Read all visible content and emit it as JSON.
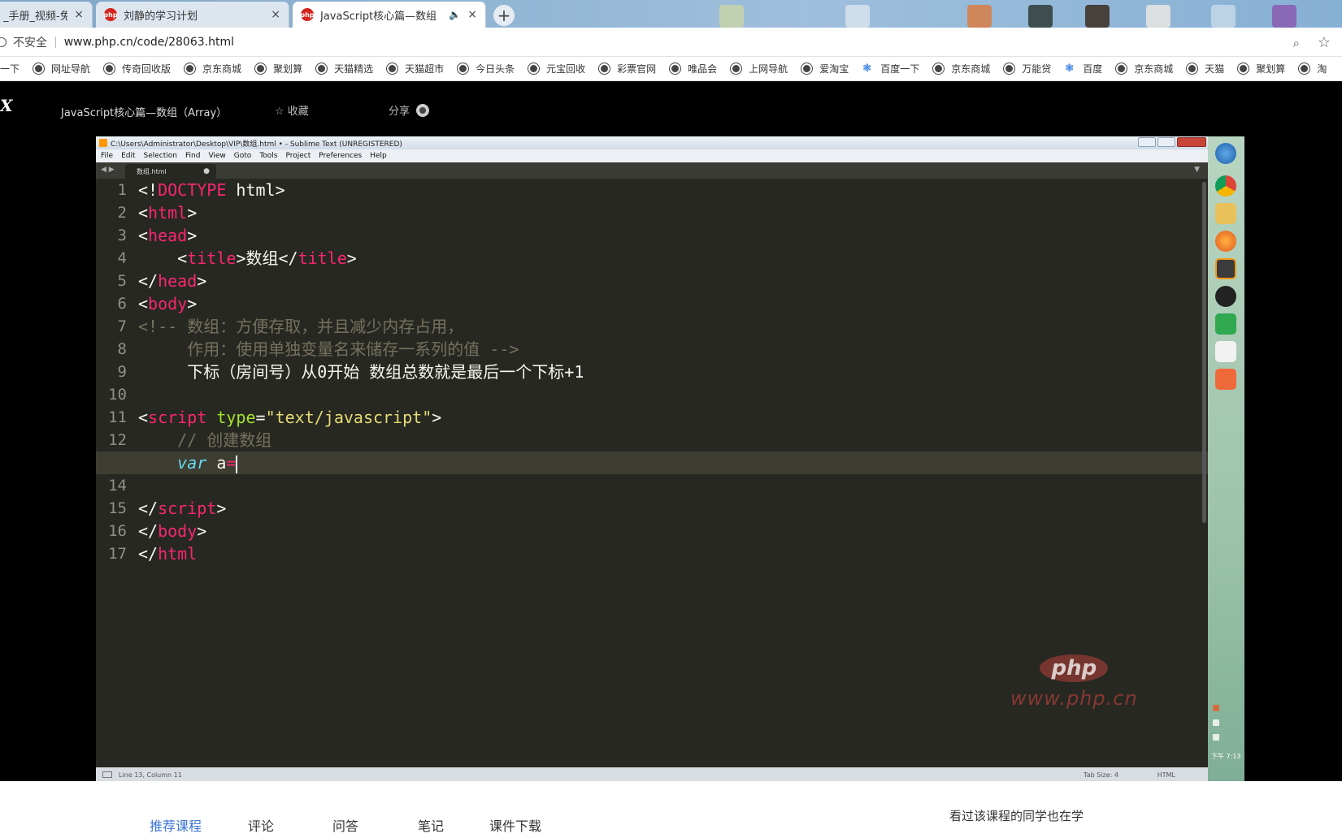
{
  "browser": {
    "tabs": [
      {
        "label": "_手册_视频-免费",
        "close": "×"
      },
      {
        "label": "刘静的学习计划",
        "close": "×",
        "icon": "php"
      },
      {
        "label": "JavaScript核心篇—数组（A",
        "close": "×",
        "icon": "php",
        "audio": "🔈"
      }
    ],
    "new_tab": "+",
    "insecure_label": "不安全",
    "url": "www.php.cn/code/28063.html",
    "bookmarks": [
      "一下",
      "网址导航",
      "传奇回收版",
      "京东商城",
      "聚划算",
      "天猫精选",
      "天猫超市",
      "今日头条",
      "元宝回收",
      "彩票官网",
      "唯品会",
      "上网导航",
      "爱淘宝",
      "百度一下",
      "京东商城",
      "万能贷",
      "百度",
      "京东商城",
      "天猫",
      "聚划算",
      "淘"
    ]
  },
  "page": {
    "logo": "X",
    "course_title": "JavaScript核心篇—数组（Array）",
    "favorite_label": "☆ 收藏",
    "share_label": "分享"
  },
  "editor": {
    "window_title": "C:\\Users\\Administrator\\Desktop\\VIP\\数组.html • - Sublime Text (UNREGISTERED)",
    "menu": [
      "File",
      "Edit",
      "Selection",
      "Find",
      "View",
      "Goto",
      "Tools",
      "Project",
      "Preferences",
      "Help"
    ],
    "tab_name": "数组.html",
    "tab_dot": "●",
    "line_numbers": [
      "1",
      "2",
      "3",
      "4",
      "5",
      "6",
      "7",
      "8",
      "9",
      "10",
      "11",
      "12",
      "13",
      "14",
      "15",
      "16",
      "17"
    ],
    "status_left": "Line 13, Column 11",
    "status_tabsize": "Tab Size: 4",
    "status_syntax": "HTML"
  },
  "taskbar": {
    "clock": "下午 7:13"
  },
  "watermark": {
    "logo": "php",
    "url": "www.php.cn"
  },
  "bottom": {
    "tabs": [
      "推荐课程",
      "评论",
      "问答",
      "笔记",
      "课件下载"
    ],
    "also_learn": "看过该课程的同学也在学"
  },
  "colors": {
    "accent": "#3e75d6",
    "editor_bg": "#272822",
    "keyword": "#f92672",
    "string": "#e6db74",
    "attr": "#a6e22e",
    "comment": "#75715e"
  }
}
